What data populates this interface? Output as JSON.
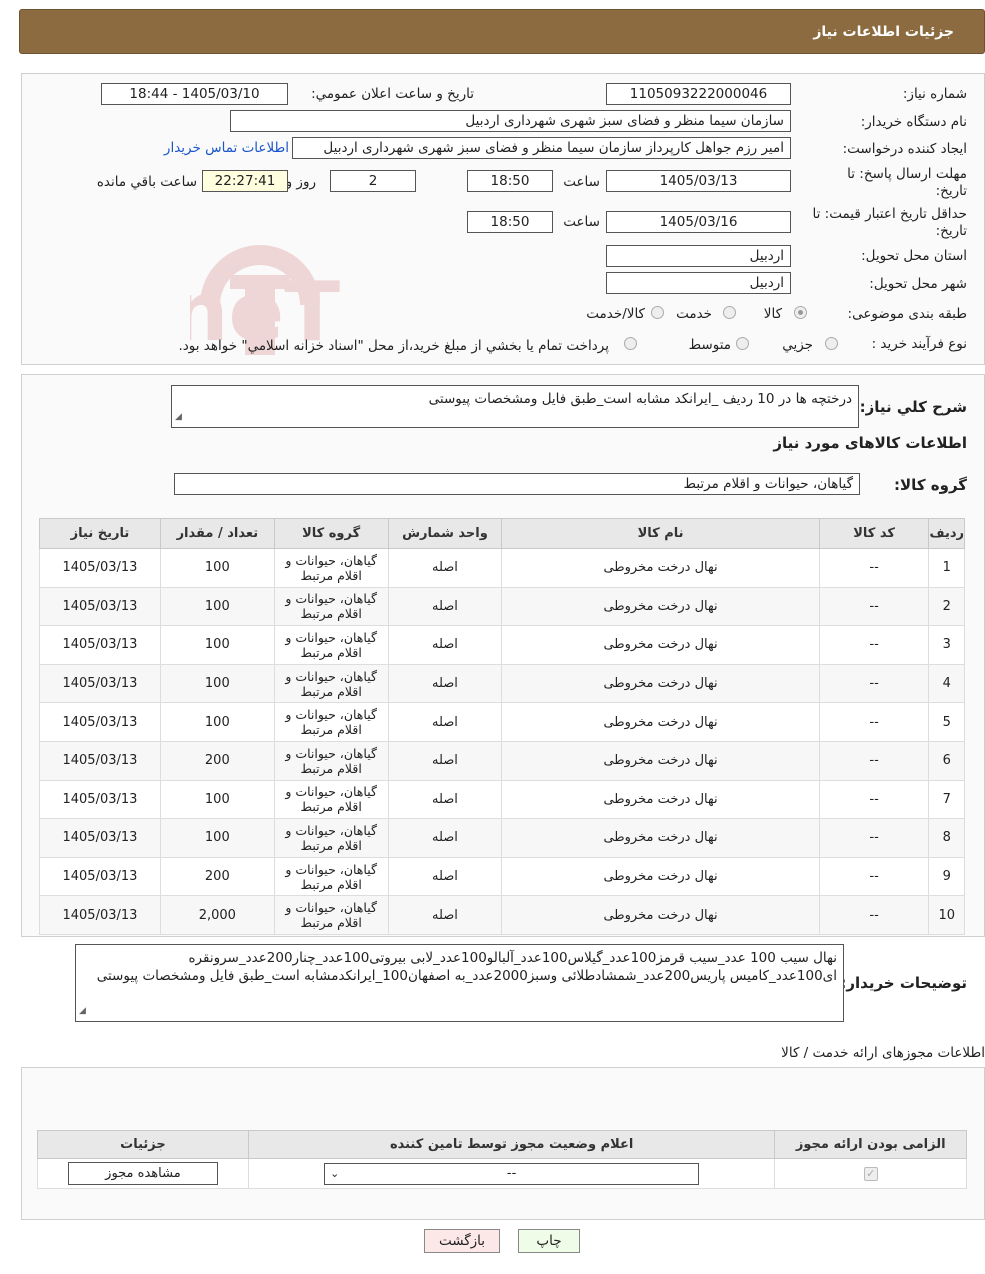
{
  "title": "جزئیات اطلاعات نیاز",
  "header": {
    "need_number_label": "شماره نیاز:",
    "need_number": "1105093222000046",
    "announce_label": "تاريخ و ساعت اعلان عمومي:",
    "announce_value": "1405/03/10 - 18:44",
    "buyer_org_label": "نام دستگاه خريدار:",
    "buyer_org": "سازمان سیما منظر و فضای سبز شهری شهرداری اردبیل",
    "creator_label": "ايجاد کننده درخواست:",
    "creator": "امیر رزم جواهل کارپرداز سازمان سیما منظر و فضای سبز شهری شهرداری اردبیل",
    "contact_link": "اطلاعات تماس خريدار",
    "reply_deadline_label": "مهلت ارسال پاسخ: تا تاريخ:",
    "reply_date": "1405/03/13",
    "time_label": "ساعت",
    "reply_time": "18:50",
    "days_value": "2",
    "days_label": "روز و",
    "remaining_value": "22:27:41",
    "remaining_label": "ساعت باقي مانده",
    "validity_label": "حداقل تاريخ اعتبار قيمت: تا تاريخ:",
    "validity_date": "1405/03/16",
    "validity_time": "18:50",
    "province_label": "استان محل تحويل:",
    "province": "اردبیل",
    "city_label": "شهر محل تحويل:",
    "city": "اردبیل",
    "category_label": "طبقه بندی موضوعی:",
    "category_options": [
      "كالا",
      "خدمت",
      "كالا/خدمت"
    ],
    "process_label": "نوع فرآيند خريد :",
    "process_options": [
      "جزيي",
      "متوسط"
    ],
    "process_note": "پرداخت تمام يا بخشي از مبلغ خريد،از محل \"اسناد خزانه اسلامي\" خواهد بود."
  },
  "description": {
    "label": "شرح کلي نياز:",
    "text": "درختچه ها در 10 ردیف _ایرانکد مشابه است_طبق فایل ومشخصات پیوستی"
  },
  "goods": {
    "section_title": "اطلاعات کالاهای مورد نياز",
    "group_label": "گروه کالا:",
    "group_value": "گیاهان، حیوانات و اقلام مرتبط",
    "columns": [
      "رديف",
      "کد کالا",
      "نام کالا",
      "واحد شمارش",
      "گروه کالا",
      "تعداد / مقدار",
      "تاريخ نياز"
    ],
    "rows": [
      {
        "idx": "1",
        "code": "--",
        "name": "نهال درخت مخروطی",
        "unit": "اصله",
        "group": "گیاهان، حیوانات و اقلام مرتبط",
        "qty": "100",
        "date": "1405/03/13"
      },
      {
        "idx": "2",
        "code": "--",
        "name": "نهال درخت مخروطی",
        "unit": "اصله",
        "group": "گیاهان، حیوانات و اقلام مرتبط",
        "qty": "100",
        "date": "1405/03/13"
      },
      {
        "idx": "3",
        "code": "--",
        "name": "نهال درخت مخروطی",
        "unit": "اصله",
        "group": "گیاهان، حیوانات و اقلام مرتبط",
        "qty": "100",
        "date": "1405/03/13"
      },
      {
        "idx": "4",
        "code": "--",
        "name": "نهال درخت مخروطی",
        "unit": "اصله",
        "group": "گیاهان، حیوانات و اقلام مرتبط",
        "qty": "100",
        "date": "1405/03/13"
      },
      {
        "idx": "5",
        "code": "--",
        "name": "نهال درخت مخروطی",
        "unit": "اصله",
        "group": "گیاهان، حیوانات و اقلام مرتبط",
        "qty": "100",
        "date": "1405/03/13"
      },
      {
        "idx": "6",
        "code": "--",
        "name": "نهال درخت مخروطی",
        "unit": "اصله",
        "group": "گیاهان، حیوانات و اقلام مرتبط",
        "qty": "200",
        "date": "1405/03/13"
      },
      {
        "idx": "7",
        "code": "--",
        "name": "نهال درخت مخروطی",
        "unit": "اصله",
        "group": "گیاهان، حیوانات و اقلام مرتبط",
        "qty": "100",
        "date": "1405/03/13"
      },
      {
        "idx": "8",
        "code": "--",
        "name": "نهال درخت مخروطی",
        "unit": "اصله",
        "group": "گیاهان، حیوانات و اقلام مرتبط",
        "qty": "100",
        "date": "1405/03/13"
      },
      {
        "idx": "9",
        "code": "--",
        "name": "نهال درخت مخروطی",
        "unit": "اصله",
        "group": "گیاهان، حیوانات و اقلام مرتبط",
        "qty": "200",
        "date": "1405/03/13"
      },
      {
        "idx": "10",
        "code": "--",
        "name": "نهال درخت مخروطی",
        "unit": "اصله",
        "group": "گیاهان، حیوانات و اقلام مرتبط",
        "qty": "2,000",
        "date": "1405/03/13"
      }
    ]
  },
  "buyer_notes": {
    "label": "توضيحات خريدار:",
    "text": "نهال سیب 100 عدد_سیب قرمز100عدد_گیلاس100عدد_آلبالو100عدد_لابی بیروتی100عدد_چنار200عدد_سرونقره ای100عدد_کامیس پاریس200عدد_شمشادطلائی وسبز2000عدد_به اصفهان100_ایرانکدمشابه است_طبق فایل ومشخصات پیوستی"
  },
  "licenses": {
    "section_title": "اطلاعات مجوزهای ارائه خدمت / کالا",
    "columns": [
      "الزامی بودن ارائه مجوز",
      "اعلام وضعيت مجوز توسط تامين کننده",
      "جزئيات"
    ],
    "select_value": "--",
    "view_button": "مشاهده مجوز"
  },
  "footer": {
    "print_button": "چاپ",
    "back_button": "بازگشت"
  },
  "watermark": "AriaTender.neT",
  "colors": {
    "title_bg": "#8b6b3f",
    "link": "#1a56c9",
    "print_bg": "#eefce8",
    "back_bg": "#fde8e8"
  }
}
